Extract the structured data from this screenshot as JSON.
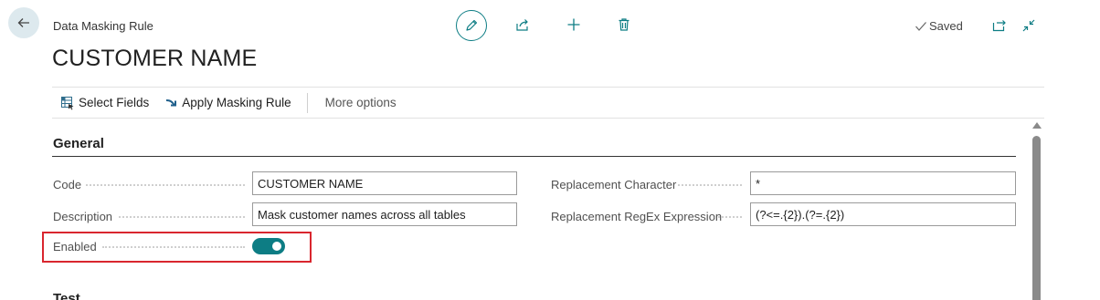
{
  "header": {
    "page_type": "Data Masking Rule",
    "title": "CUSTOMER NAME",
    "status": "Saved",
    "icons": {
      "back": "back-arrow-icon",
      "edit": "pencil-icon",
      "share": "share-icon",
      "new": "plus-icon",
      "delete": "trash-icon",
      "open_new_window": "open-in-new-window-icon",
      "collapse": "collapse-icon"
    }
  },
  "actions": {
    "select_fields": "Select Fields",
    "apply_masking_rule": "Apply Masking Rule",
    "more_options": "More options"
  },
  "general": {
    "title": "General",
    "code_label": "Code",
    "code_value": "CUSTOMER NAME",
    "description_label": "Description",
    "description_value": "Mask customer names across all tables",
    "enabled_label": "Enabled",
    "enabled_value": true,
    "replacement_character_label": "Replacement Character",
    "replacement_character_value": "*",
    "replacement_regex_label": "Replacement RegEx Expression",
    "replacement_regex_value": "(?<=.{2}).(?=.{2})"
  },
  "next_section": {
    "title": "Test"
  },
  "colors": {
    "accent": "#0d7d84",
    "highlight": "#d9262e"
  }
}
